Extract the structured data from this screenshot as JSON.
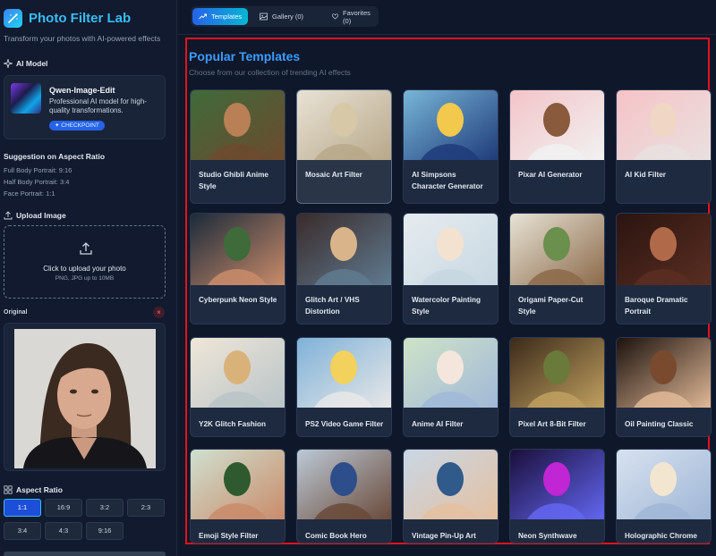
{
  "app": {
    "title": "Photo Filter Lab",
    "subtitle": "Transform your photos with AI-powered effects"
  },
  "ai_model": {
    "section_title": "AI Model",
    "name": "Qwen-Image-Edit",
    "description": "Professional AI model for high-quality transformations.",
    "badge": "✦ CHECKPOINT"
  },
  "aspect_suggestion": {
    "title": "Suggestion on Aspect Ratio",
    "lines": [
      "Full Body Portrait: 9:16",
      "Half Body Portrait: 3:4",
      "Face Portrait: 1:1"
    ]
  },
  "upload": {
    "section_title": "Upload Image",
    "main_text": "Click to upload your photo",
    "sub_text": "PNG, JPG up to 10MB"
  },
  "original": {
    "label": "Original",
    "close_icon": "×"
  },
  "aspect_ratio": {
    "section_title": "Aspect Ratio",
    "options": [
      "1:1",
      "16:9",
      "3:2",
      "2:3",
      "3:4",
      "4:3",
      "9:16"
    ],
    "selected": "1:1"
  },
  "tabs": [
    {
      "label": "Templates",
      "icon": "trending-icon",
      "active": true
    },
    {
      "label": "Gallery (0)",
      "icon": "image-icon",
      "active": false
    },
    {
      "label": "Favorites (0)",
      "icon": "heart-icon",
      "active": false
    }
  ],
  "templates": {
    "title": "Popular Templates",
    "subtitle": "Choose from our collection of trending AI effects",
    "items": [
      {
        "label": "Studio Ghibli Anime Style"
      },
      {
        "label": "Mosaic Art Filter"
      },
      {
        "label": "AI Simpsons Character Generator"
      },
      {
        "label": "Pixar AI Generator"
      },
      {
        "label": "AI Kid Filter"
      },
      {
        "label": "Cyberpunk Neon Style"
      },
      {
        "label": "Glitch Art / VHS Distortion"
      },
      {
        "label": "Watercolor Painting Style"
      },
      {
        "label": "Origami Paper-Cut Style"
      },
      {
        "label": "Baroque Dramatic Portrait"
      },
      {
        "label": "Y2K Glitch Fashion"
      },
      {
        "label": "PS2 Video Game Filter"
      },
      {
        "label": "Anime AI Filter"
      },
      {
        "label": "Pixel Art 8-Bit Filter"
      },
      {
        "label": "Oil Painting Classic"
      },
      {
        "label": "Emoji Style Filter"
      },
      {
        "label": "Comic Book Hero"
      },
      {
        "label": "Vintage Pin-Up Art"
      },
      {
        "label": "Neon Synthwave"
      },
      {
        "label": "Holographic Chrome"
      }
    ],
    "selected_index": 1
  },
  "colors": {
    "accent": "#38bdf8",
    "primary": "#2563eb",
    "frame": "#e5121b"
  }
}
